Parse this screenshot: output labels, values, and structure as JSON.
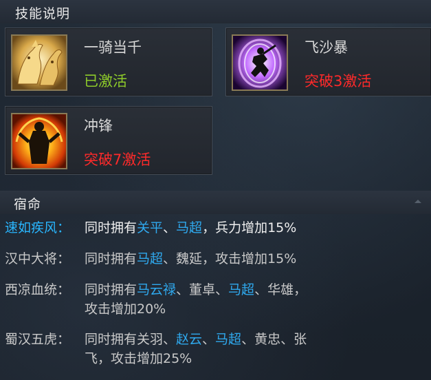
{
  "skills_section": {
    "title": "技能说明"
  },
  "skills": [
    {
      "name": "一骑当千",
      "status": "已激活",
      "status_color": "#8ecb2a",
      "icon": "golden-horses-icon"
    },
    {
      "name": "飞沙暴",
      "status": "突破3激活",
      "status_color": "#ff2a2a",
      "icon": "whirlwind-warrior-icon"
    },
    {
      "name": "冲锋",
      "status": "突破7激活",
      "status_color": "#ff2a2a",
      "icon": "fire-warrior-icon"
    }
  ],
  "fate_section": {
    "title": "宿命"
  },
  "fates": [
    {
      "name": "速如疾风：",
      "active": true,
      "prefix": "同时拥有",
      "heroes": [
        "关平",
        "马超"
      ],
      "sep": "、",
      "suffix": "，兵力增加15%"
    },
    {
      "name": "汉中大将：",
      "active": false,
      "prefix": "同时拥有",
      "h1": "马超",
      "mid": "、魏延，攻击增加15%"
    },
    {
      "name": "西凉血统：",
      "active": false,
      "line1_prefix": "同时拥有",
      "h1": "马云禄",
      "mid1": "、董卓、",
      "h2": "马超",
      "line1_suffix": "、华雄，",
      "line2": "攻击增加20%"
    },
    {
      "name": "蜀汉五虎：",
      "active": false,
      "line1_prefix": "同时拥有关羽、",
      "h1": "赵云",
      "sep": "、",
      "h2": "马超",
      "line1_suffix": "、黄忠、张",
      "line2": "飞，攻击增加25%"
    }
  ],
  "colors": {
    "hero_highlight": "#2fa9ee",
    "active_fate": "#29b6ff"
  }
}
